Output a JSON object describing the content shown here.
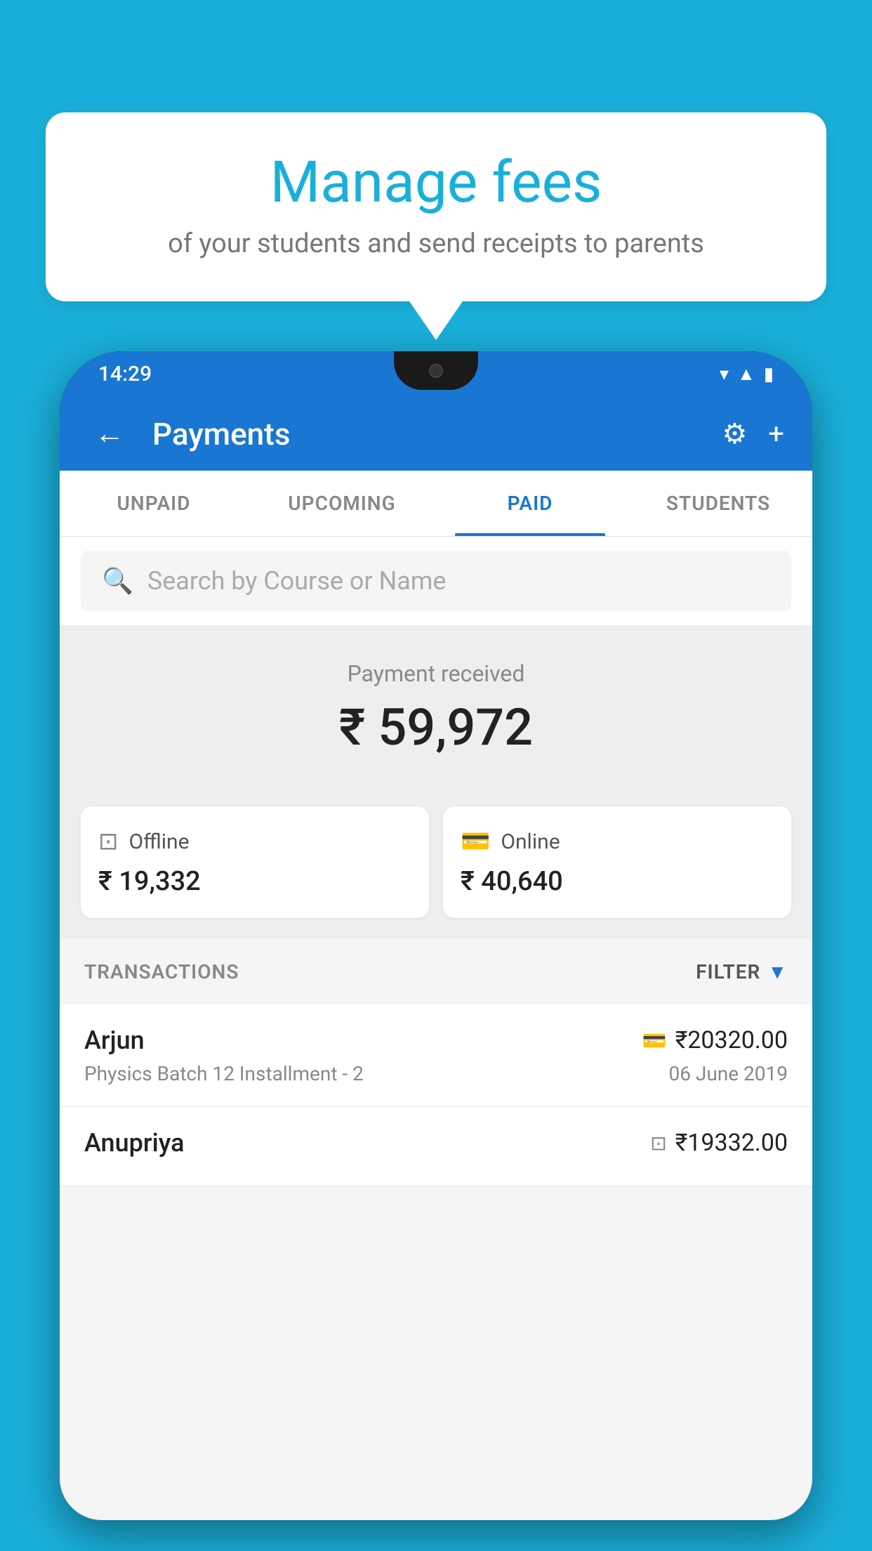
{
  "page": {
    "background_color": "#1AAFDA"
  },
  "bubble": {
    "title": "Manage fees",
    "subtitle": "of your students and send receipts to parents"
  },
  "status_bar": {
    "time": "14:29"
  },
  "app_bar": {
    "title": "Payments",
    "back_label": "←",
    "settings_label": "⚙",
    "add_label": "+"
  },
  "tabs": [
    {
      "label": "UNPAID",
      "active": false
    },
    {
      "label": "UPCOMING",
      "active": false
    },
    {
      "label": "PAID",
      "active": true
    },
    {
      "label": "STUDENTS",
      "active": false
    }
  ],
  "search": {
    "placeholder": "Search by Course or Name"
  },
  "payment_received": {
    "label": "Payment received",
    "amount": "₹ 59,972"
  },
  "payment_cards": [
    {
      "type": "Offline",
      "amount": "₹ 19,332",
      "icon": "offline"
    },
    {
      "type": "Online",
      "amount": "₹ 40,640",
      "icon": "online"
    }
  ],
  "transactions": {
    "header": "TRANSACTIONS",
    "filter_label": "FILTER"
  },
  "transaction_rows": [
    {
      "name": "Arjun",
      "amount": "₹20320.00",
      "course": "Physics Batch 12 Installment - 2",
      "date": "06 June 2019",
      "payment_type": "card"
    },
    {
      "name": "Anupriya",
      "amount": "₹19332.00",
      "course": "",
      "date": "",
      "payment_type": "offline"
    }
  ]
}
